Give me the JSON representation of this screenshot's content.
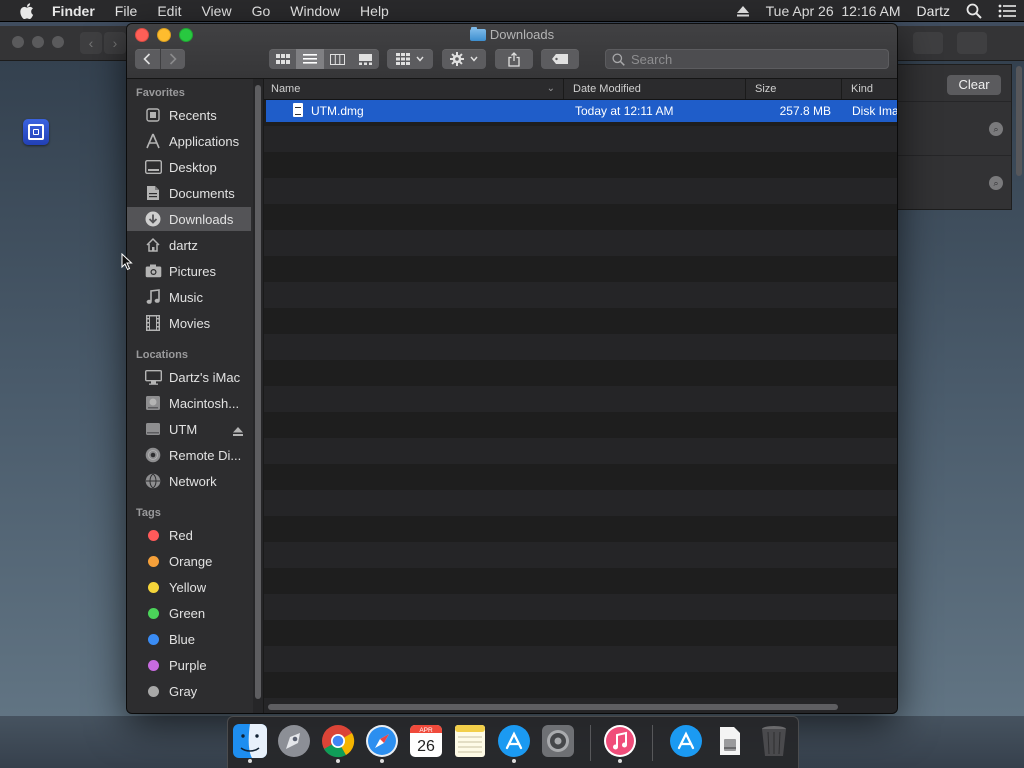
{
  "menubar": {
    "app_name": "Finder",
    "menus": [
      "File",
      "Edit",
      "View",
      "Go",
      "Window",
      "Help"
    ],
    "datetime": "Tue Apr 26  12:16 AM",
    "user": "Dartz"
  },
  "background_app": {
    "clear_label": "Clear"
  },
  "window": {
    "title": "Downloads",
    "search_placeholder": "Search"
  },
  "sidebar": {
    "favorites_header": "Favorites",
    "favorites": [
      {
        "label": "Recents",
        "icon": "recents-icon"
      },
      {
        "label": "Applications",
        "icon": "applications-icon"
      },
      {
        "label": "Desktop",
        "icon": "desktop-icon"
      },
      {
        "label": "Documents",
        "icon": "documents-icon"
      },
      {
        "label": "Downloads",
        "icon": "downloads-icon",
        "selected": true
      },
      {
        "label": "dartz",
        "icon": "home-icon"
      },
      {
        "label": "Pictures",
        "icon": "pictures-icon"
      },
      {
        "label": "Music",
        "icon": "music-icon"
      },
      {
        "label": "Movies",
        "icon": "movies-icon"
      }
    ],
    "locations_header": "Locations",
    "locations": [
      {
        "label": "Dartz's iMac",
        "icon": "computer-icon"
      },
      {
        "label": "Macintosh...",
        "icon": "hard-disk-icon"
      },
      {
        "label": "UTM",
        "icon": "disk-image-icon"
      },
      {
        "label": "Remote Di...",
        "icon": "remote-disc-icon"
      },
      {
        "label": "Network",
        "icon": "network-icon"
      }
    ],
    "tags_header": "Tags",
    "tags": [
      {
        "label": "Red",
        "color": "#ff5a5a"
      },
      {
        "label": "Orange",
        "color": "#f5a03a"
      },
      {
        "label": "Yellow",
        "color": "#f5d53a"
      },
      {
        "label": "Green",
        "color": "#4bd45a"
      },
      {
        "label": "Blue",
        "color": "#3a8cf5"
      },
      {
        "label": "Purple",
        "color": "#c86be0"
      },
      {
        "label": "Gray",
        "color": "#a8a8a8"
      }
    ]
  },
  "file_list": {
    "columns": [
      "Name",
      "Date Modified",
      "Size",
      "Kind"
    ],
    "rows": [
      {
        "name": "UTM.dmg",
        "date_modified": "Today at 12:11 AM",
        "size": "257.8 MB",
        "kind": "Disk Ima"
      }
    ]
  },
  "dock": {
    "apps": [
      "finder-icon",
      "launchpad-icon",
      "chrome-icon",
      "safari-icon",
      "calendar-icon",
      "notes-icon",
      "app-store-icon",
      "system-preferences-icon",
      "itunes-icon",
      "applications-folder-icon",
      "downloads-stack-icon",
      "trash-icon"
    ],
    "calendar_month": "APR",
    "calendar_day": "26"
  },
  "colors": {
    "selection": "#1f5dc9",
    "menubar": "#2a2a2c"
  }
}
